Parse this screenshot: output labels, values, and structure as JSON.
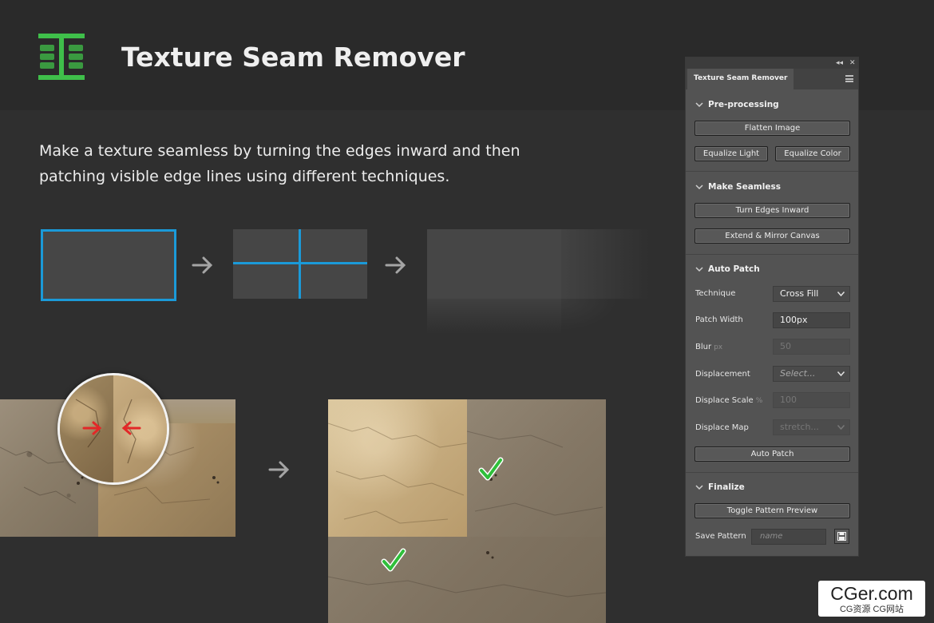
{
  "header": {
    "title": "Texture Seam Remover"
  },
  "description": {
    "line1": "Make a texture seamless by turning the edges inward and then",
    "line2": "patching visible edge lines using different techniques."
  },
  "icons": {
    "logo": "seam-logo-icon",
    "arrow": "arrow-right-icon",
    "check": "check-mark-icon"
  },
  "colors": {
    "accent_blue": "#1b9ad8",
    "logo_green": "#3fbf4a",
    "check_green": "#2fbf3a",
    "arrow_red": "#e22828",
    "panel_bg": "#535353",
    "page_bg": "#2f2f2f"
  },
  "panel": {
    "tab_label": "Texture Seam Remover",
    "controls": {
      "collapse": "◂◂",
      "close": "✕"
    },
    "preprocessing": {
      "title": "Pre-processing",
      "flatten": "Flatten Image",
      "equalize_light": "Equalize Light",
      "equalize_color": "Equalize Color"
    },
    "make_seamless": {
      "title": "Make Seamless",
      "turn_edges": "Turn Edges Inward",
      "extend_mirror": "Extend & Mirror Canvas"
    },
    "auto_patch": {
      "title": "Auto Patch",
      "technique_label": "Technique",
      "technique_value": "Cross Fill",
      "patch_width_label": "Patch Width",
      "patch_width_value": "100px",
      "blur_label": "Blur",
      "blur_unit": "px",
      "blur_value": "50",
      "displacement_label": "Displacement",
      "displacement_value": "Select...",
      "displace_scale_label": "Displace Scale",
      "displace_scale_unit": "%",
      "displace_scale_value": "100",
      "displace_map_label": "Displace Map",
      "displace_map_value": "stretch...",
      "button": "Auto Patch"
    },
    "finalize": {
      "title": "Finalize",
      "toggle_preview": "Toggle Pattern Preview",
      "save_label": "Save Pattern",
      "save_placeholder": "name"
    }
  },
  "watermark": {
    "main": "CGer.com",
    "sub": "CG资源 CG网站"
  }
}
